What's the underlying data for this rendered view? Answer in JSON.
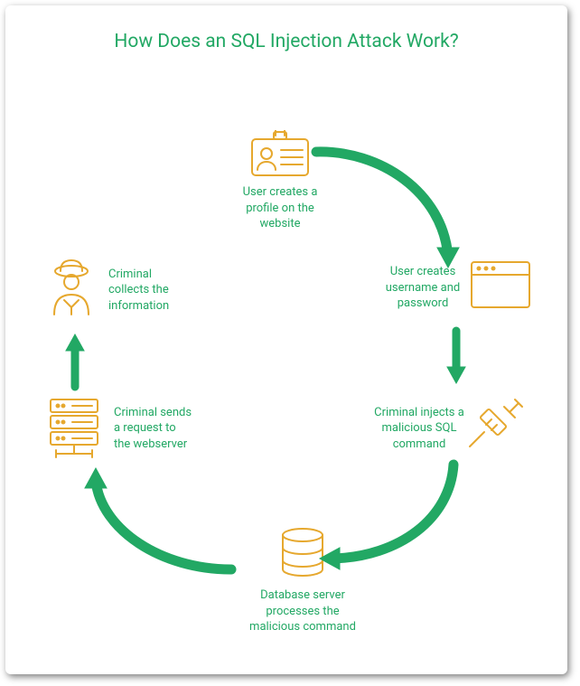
{
  "title": "How Does an SQL Injection Attack Work?",
  "steps": {
    "profile": {
      "label": "User creates a profile on the website",
      "icon": "id-badge-icon"
    },
    "creds": {
      "label": "User creates username and password",
      "icon": "browser-window-icon"
    },
    "inject": {
      "label": "Criminal injects a malicious SQL command",
      "icon": "syringe-icon"
    },
    "dbproc": {
      "label": "Database server processes the malicious command",
      "icon": "database-icon"
    },
    "request": {
      "label": "Criminal sends a request to the webserver",
      "icon": "server-rack-icon"
    },
    "collect": {
      "label": "Criminal collects the information",
      "icon": "hacker-icon"
    }
  },
  "colors": {
    "accent": "#22a864",
    "icon": "#e6a82e"
  }
}
